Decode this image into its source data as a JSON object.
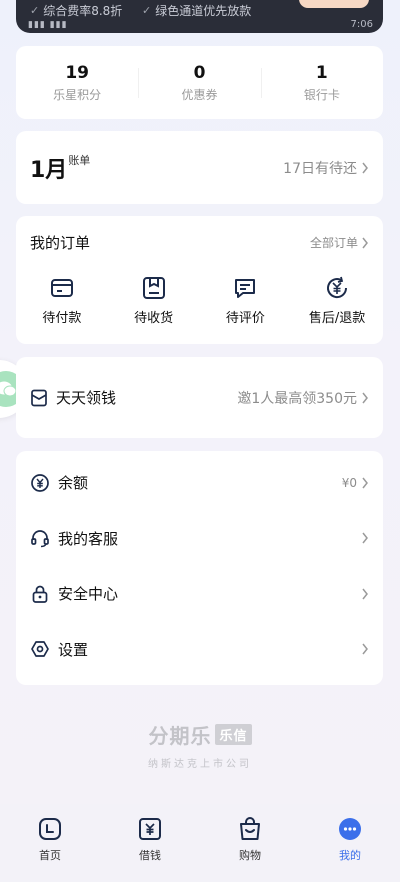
{
  "topbar": {
    "perk1": "综合费率8.8折",
    "perk2": "绿色通道优先放款",
    "time": "7:06"
  },
  "stats": [
    {
      "value": "19",
      "label": "乐星积分"
    },
    {
      "value": "0",
      "label": "优惠券"
    },
    {
      "value": "1",
      "label": "银行卡"
    }
  ],
  "bill": {
    "month": "1月",
    "suffix": "账单",
    "status": "17日有待还"
  },
  "orders": {
    "title": "我的订单",
    "all_label": "全部订单",
    "items": [
      {
        "label": "待付款",
        "icon": "wallet-icon"
      },
      {
        "label": "待收货",
        "icon": "box-icon"
      },
      {
        "label": "待评价",
        "icon": "comment-icon"
      },
      {
        "label": "售后/退款",
        "icon": "refund-icon"
      }
    ]
  },
  "earn": {
    "title": "天天领钱",
    "promo": "邀1人最高领350元"
  },
  "menu": [
    {
      "label": "余额",
      "value": "¥0",
      "icon": "yuan-circle-icon"
    },
    {
      "label": "我的客服",
      "value": "",
      "icon": "headset-icon"
    },
    {
      "label": "安全中心",
      "value": "",
      "icon": "lock-icon"
    },
    {
      "label": "设置",
      "value": "",
      "icon": "settings-hexagon-icon"
    }
  ],
  "brand": {
    "name": "分期乐",
    "tag": "乐信",
    "subtitle": "纳斯达克上市公司"
  },
  "tabs": [
    {
      "label": "首页",
      "icon": "home-icon",
      "active": false
    },
    {
      "label": "借钱",
      "icon": "loan-icon",
      "active": false
    },
    {
      "label": "购物",
      "icon": "shopping-bag-icon",
      "active": false
    },
    {
      "label": "我的",
      "icon": "profile-dots-icon",
      "active": true
    }
  ],
  "colors": {
    "accent": "#3b6fea",
    "text": "#111111",
    "muted": "#8c8c8c",
    "background": "#f3f2f8"
  }
}
